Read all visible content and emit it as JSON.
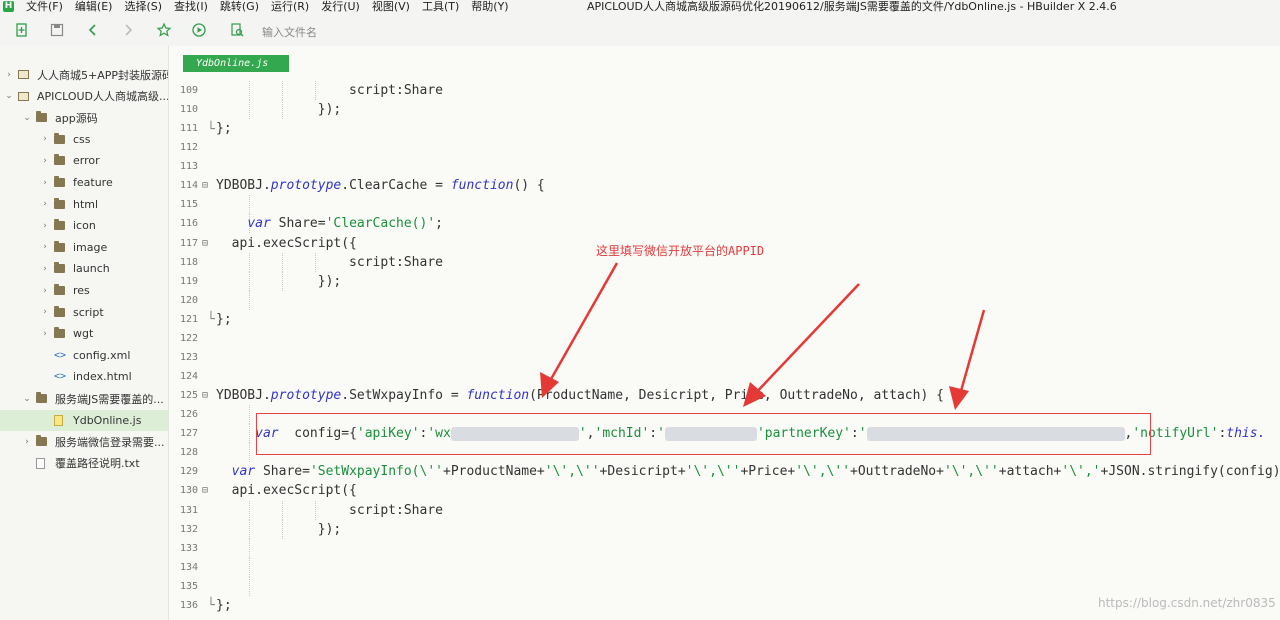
{
  "app": {
    "window_title": "APICLOUD人人商城高级版源码优化20190612/服务端JS需要覆盖的文件/YdbOnline.js - HBuilder X 2.4.6",
    "logo": "H",
    "menus": [
      "文件(F)",
      "编辑(E)",
      "选择(S)",
      "查找(I)",
      "跳转(G)",
      "运行(R)",
      "发行(U)",
      "视图(V)",
      "工具(T)",
      "帮助(Y)"
    ]
  },
  "toolbar": {
    "file_search_placeholder": "输入文件名",
    "icons": [
      "new-file-icon",
      "save-icon",
      "back-icon",
      "forward-icon",
      "star-icon",
      "run-icon",
      "browser-preview-icon"
    ]
  },
  "sidebar": {
    "items": [
      {
        "label": "人人商城5+APP封装版源码",
        "icon": "project-icon",
        "depth": 0,
        "expanded": false
      },
      {
        "label": "APICLOUD人人商城高级...",
        "icon": "project-icon",
        "depth": 0,
        "expanded": true
      },
      {
        "label": "app源码",
        "icon": "folder-icon",
        "depth": 1,
        "expanded": true
      },
      {
        "label": "css",
        "icon": "folder-icon",
        "depth": 2,
        "expanded": false
      },
      {
        "label": "error",
        "icon": "folder-icon",
        "depth": 2,
        "expanded": false
      },
      {
        "label": "feature",
        "icon": "folder-icon",
        "depth": 2,
        "expanded": false
      },
      {
        "label": "html",
        "icon": "folder-icon",
        "depth": 2,
        "expanded": false
      },
      {
        "label": "icon",
        "icon": "folder-icon",
        "depth": 2,
        "expanded": false
      },
      {
        "label": "image",
        "icon": "folder-icon",
        "depth": 2,
        "expanded": false
      },
      {
        "label": "launch",
        "icon": "folder-icon",
        "depth": 2,
        "expanded": false
      },
      {
        "label": "res",
        "icon": "folder-icon",
        "depth": 2,
        "expanded": false
      },
      {
        "label": "script",
        "icon": "folder-icon",
        "depth": 2,
        "expanded": false
      },
      {
        "label": "wgt",
        "icon": "folder-icon",
        "depth": 2,
        "expanded": false
      },
      {
        "label": "config.xml",
        "icon": "xml-file-icon",
        "depth": 2,
        "expanded": null
      },
      {
        "label": "index.html",
        "icon": "html-file-icon",
        "depth": 2,
        "expanded": null
      },
      {
        "label": "服务端JS需要覆盖的...",
        "icon": "folder-icon",
        "depth": 1,
        "expanded": true
      },
      {
        "label": "YdbOnline.js",
        "icon": "js-file-icon",
        "depth": 2,
        "expanded": null,
        "selected": true
      },
      {
        "label": "服务端微信登录需要...",
        "icon": "folder-icon",
        "depth": 1,
        "expanded": false
      },
      {
        "label": "覆盖路径说明.txt",
        "icon": "txt-file-icon",
        "depth": 1,
        "expanded": null
      }
    ]
  },
  "editor": {
    "tab_label": "YdbOnline.js",
    "annotation": "这里填写微信开放平台的APPID",
    "watermark": "https://blog.csdn.net/zhr0835",
    "lines": [
      {
        "num": "109",
        "fold": "",
        "guides": 3,
        "parts": [
          {
            "t": "                 script:Share",
            "c": ""
          }
        ]
      },
      {
        "num": "110",
        "fold": "",
        "guides": 2,
        "parts": [
          {
            "t": "             });",
            "c": ""
          }
        ]
      },
      {
        "num": "111",
        "fold": "",
        "guides": 0,
        "parts": [
          {
            "t": "};",
            "c": ""
          }
        ]
      },
      {
        "num": "112",
        "fold": "",
        "guides": 0,
        "parts": []
      },
      {
        "num": "113",
        "fold": "",
        "guides": 0,
        "parts": []
      },
      {
        "num": "114",
        "fold": "⊟",
        "guides": 0,
        "parts": [
          {
            "t": "YDBOBJ.",
            "c": ""
          },
          {
            "t": "prototype",
            "c": "kw"
          },
          {
            "t": ".ClearCache = ",
            "c": ""
          },
          {
            "t": "function",
            "c": "kw"
          },
          {
            "t": "() {",
            "c": ""
          }
        ]
      },
      {
        "num": "115",
        "fold": "",
        "guides": 1,
        "parts": []
      },
      {
        "num": "116",
        "fold": "",
        "guides": 1,
        "parts": [
          {
            "t": "    ",
            "c": ""
          },
          {
            "t": "var",
            "c": "kw"
          },
          {
            "t": " Share=",
            "c": ""
          },
          {
            "t": "'ClearCache()'",
            "c": "str"
          },
          {
            "t": ";",
            "c": ""
          }
        ]
      },
      {
        "num": "117",
        "fold": "⊟",
        "guides": 0,
        "parts": [
          {
            "t": "  api.execScript({",
            "c": ""
          }
        ]
      },
      {
        "num": "118",
        "fold": "",
        "guides": 3,
        "parts": [
          {
            "t": "                 script:Share",
            "c": ""
          }
        ]
      },
      {
        "num": "119",
        "fold": "",
        "guides": 2,
        "parts": [
          {
            "t": "             });",
            "c": ""
          }
        ]
      },
      {
        "num": "120",
        "fold": "",
        "guides": 1,
        "parts": []
      },
      {
        "num": "121",
        "fold": "",
        "guides": 0,
        "parts": [
          {
            "t": "};",
            "c": ""
          }
        ]
      },
      {
        "num": "122",
        "fold": "",
        "guides": 0,
        "parts": []
      },
      {
        "num": "123",
        "fold": "",
        "guides": 0,
        "parts": []
      },
      {
        "num": "124",
        "fold": "",
        "guides": 0,
        "parts": []
      },
      {
        "num": "125",
        "fold": "⊟",
        "guides": 0,
        "parts": [
          {
            "t": "YDBOBJ.",
            "c": ""
          },
          {
            "t": "prototype",
            "c": "kw"
          },
          {
            "t": ".SetWxpayInfo = ",
            "c": ""
          },
          {
            "t": "function",
            "c": "kw"
          },
          {
            "t": "(ProductName, Desicript, Price, OuttradeNo, attach) {",
            "c": ""
          }
        ]
      },
      {
        "num": "126",
        "fold": "",
        "guides": 1,
        "parts": []
      },
      {
        "num": "127",
        "fold": "",
        "guides": 1,
        "parts": [
          {
            "t": "     ",
            "c": ""
          },
          {
            "t": "var",
            "c": "kw"
          },
          {
            "t": "  config={",
            "c": ""
          },
          {
            "t": "'apiKey'",
            "c": "str"
          },
          {
            "t": ":",
            "c": ""
          },
          {
            "t": "'wx",
            "c": "str"
          },
          {
            "t": "",
            "c": "blur",
            "w": 128
          },
          {
            "t": "'",
            "c": "str"
          },
          {
            "t": ",",
            "c": ""
          },
          {
            "t": "'mchId'",
            "c": "str"
          },
          {
            "t": ":",
            "c": ""
          },
          {
            "t": "'",
            "c": "str"
          },
          {
            "t": "",
            "c": "blur",
            "w": 92
          },
          {
            "t": "'partnerKey'",
            "c": "str"
          },
          {
            "t": ":",
            "c": ""
          },
          {
            "t": "'",
            "c": "str"
          },
          {
            "t": "",
            "c": "blur",
            "w": 258
          },
          {
            "t": ",",
            "c": ""
          },
          {
            "t": "'notifyUrl'",
            "c": "str"
          },
          {
            "t": ":",
            "c": ""
          },
          {
            "t": "this.",
            "c": "kw"
          }
        ]
      },
      {
        "num": "128",
        "fold": "",
        "guides": 1,
        "parts": []
      },
      {
        "num": "129",
        "fold": "",
        "guides": 0,
        "parts": [
          {
            "t": "  ",
            "c": ""
          },
          {
            "t": "var",
            "c": "kw"
          },
          {
            "t": " Share=",
            "c": ""
          },
          {
            "t": "'SetWxpayInfo(\\''",
            "c": "str"
          },
          {
            "t": "+ProductName+",
            "c": ""
          },
          {
            "t": "'\\',\\''",
            "c": "str"
          },
          {
            "t": "+Desicript+",
            "c": ""
          },
          {
            "t": "'\\',\\''",
            "c": "str"
          },
          {
            "t": "+Price+",
            "c": ""
          },
          {
            "t": "'\\',\\''",
            "c": "str"
          },
          {
            "t": "+OuttradeNo+",
            "c": ""
          },
          {
            "t": "'\\',\\''",
            "c": "str"
          },
          {
            "t": "+attach+",
            "c": ""
          },
          {
            "t": "'\\','",
            "c": "str"
          },
          {
            "t": "+JSON.stringify(config)",
            "c": ""
          }
        ]
      },
      {
        "num": "130",
        "fold": "⊟",
        "guides": 0,
        "parts": [
          {
            "t": "  api.execScript({",
            "c": ""
          }
        ]
      },
      {
        "num": "131",
        "fold": "",
        "guides": 3,
        "parts": [
          {
            "t": "                 script:Share",
            "c": ""
          }
        ]
      },
      {
        "num": "132",
        "fold": "",
        "guides": 2,
        "parts": [
          {
            "t": "             });",
            "c": ""
          }
        ]
      },
      {
        "num": "133",
        "fold": "",
        "guides": 1,
        "parts": []
      },
      {
        "num": "134",
        "fold": "",
        "guides": 1,
        "parts": []
      },
      {
        "num": "135",
        "fold": "",
        "guides": 1,
        "parts": []
      },
      {
        "num": "136",
        "fold": "",
        "guides": 0,
        "parts": [
          {
            "t": "};",
            "c": ""
          }
        ]
      }
    ]
  }
}
